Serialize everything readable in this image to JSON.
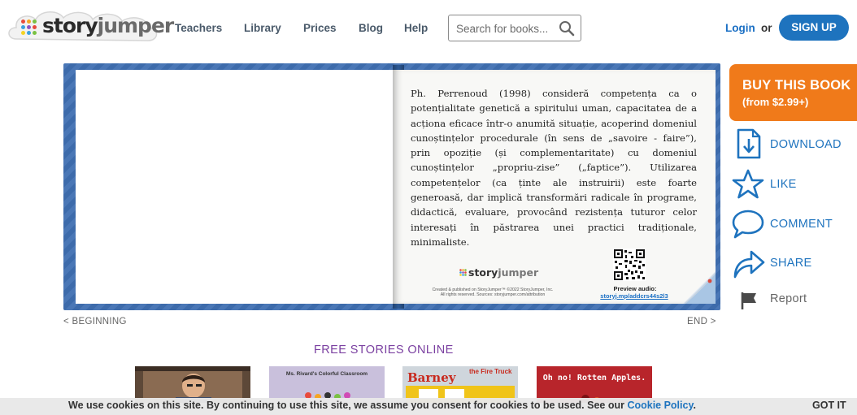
{
  "header": {
    "logo": {
      "story": "story",
      "jumper": "jumper"
    },
    "nav": [
      {
        "label": "Teachers"
      },
      {
        "label": "Library"
      },
      {
        "label": "Prices"
      },
      {
        "label": "Blog"
      },
      {
        "label": "Help"
      }
    ],
    "search": {
      "placeholder": "Search for books..."
    },
    "login_label": "Login",
    "or_label": "or",
    "signup_label": "SIGN UP"
  },
  "book": {
    "page_text": "Ph. Perrenoud (1998) consideră competența ca o potențialitate genetică a spiritului uman, capacitatea de a acționa eficace într-o anumită situație, acoperind domeniul cunoștințelor procedurale (în sens de „savoire - faire”), prin opoziție (și complementaritate) cu domeniul cunoștințelor „propriu-zise” („faptice”). Utilizarea competențelor (ca ținte ale instruirii) este foarte generoasă, dar implică transformări  radicale în programe, didactică, evaluare, provocând rezistența tuturor celor interesați în păstrarea unei practici tradiționale, minimaliste.",
    "page_logo": {
      "story": "story",
      "jumper": "jumper"
    },
    "credit_line1": "Created & published on StoryJumper™ ©2022 StoryJumper, Inc.",
    "credit_line2": "All rights reserved. Sources: storyjumper.com/attribution",
    "preview_label": "Preview audio:",
    "preview_link": "storyj.mp/addcrs44s2l3",
    "nav_beginning": "< BEGINNING",
    "nav_end": "END >"
  },
  "actions": {
    "buy_title": "BUY THIS BOOK",
    "buy_price": "(from $2.99+)",
    "download": "DOWNLOAD",
    "like": "LIKE",
    "comment": "COMMENT",
    "share": "SHARE",
    "report": "Report"
  },
  "free_stories": {
    "title": "FREE STORIES ONLINE",
    "books": [
      {
        "title": ""
      },
      {
        "title": "Ms. Rivard's Colorful Classroom"
      },
      {
        "title": "Barney",
        "subtitle": "the Fire Truck"
      },
      {
        "title": "Oh no! Rotten Apples."
      }
    ]
  },
  "cookie": {
    "text": "We use cookies on this site. By continuing to use this site, we assume you consent for cookies to be used. See our ",
    "link": "Cookie Policy",
    "suffix": ".",
    "button": "GOT IT"
  },
  "colors": {
    "brand_blue": "#1e73be",
    "book_frame": "#3f6fb2",
    "buy_orange": "#f07a1a",
    "free_title": "#7a3fa0"
  }
}
